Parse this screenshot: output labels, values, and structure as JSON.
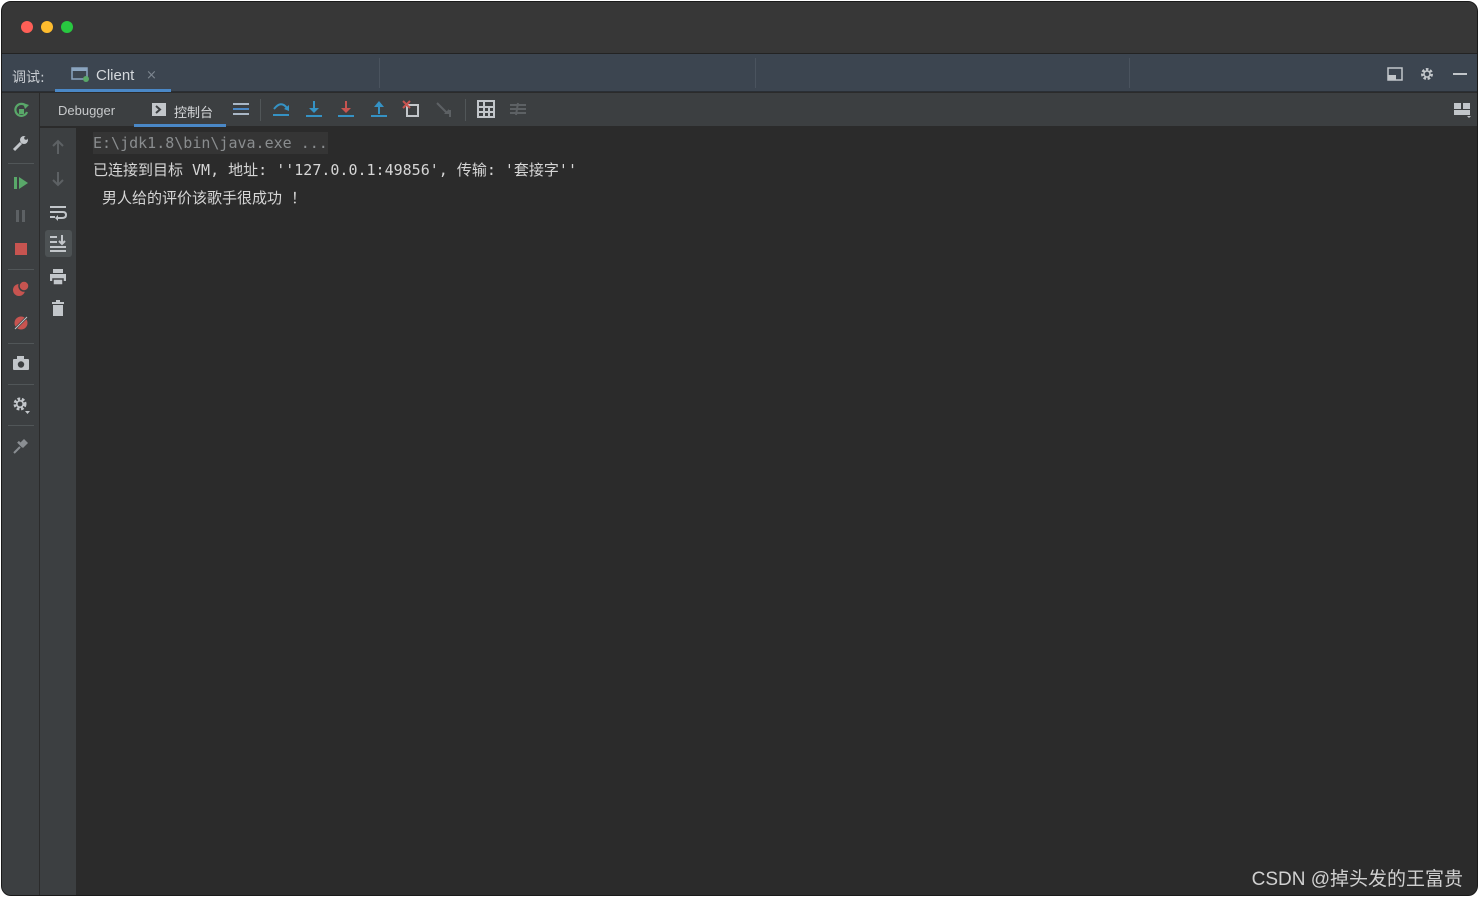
{
  "header": {
    "debug_label": "调试:",
    "client_tab": {
      "label": "Client",
      "close": "×"
    }
  },
  "tabs": {
    "debugger": "Debugger",
    "console": "控制台"
  },
  "console": {
    "lines": [
      "E:\\jdk1.8\\bin\\java.exe ...",
      "已连接到目标 VM, 地址: ''127.0.0.1:49856', 传输: '套接字''",
      " 男人给的评价该歌手很成功 ！"
    ]
  },
  "watermark": "CSDN @掉头发的王富贵",
  "colors": {
    "accent": "#4a88c7",
    "background": "#2b2b2b",
    "toolbar": "#3c3f41",
    "header": "#3c4550",
    "resume_green": "#59a869",
    "stop_red": "#c75450"
  },
  "icons": {
    "left_toolbar": [
      "rerun-icon",
      "settings-wrench-icon",
      "resume-icon",
      "pause-icon",
      "stop-icon",
      "view-breakpoints-icon",
      "mute-breakpoints-icon",
      "camera-icon",
      "gear-icon",
      "pin-icon"
    ],
    "console_toolbar": [
      "up-arrow-icon",
      "down-arrow-icon",
      "soft-wrap-icon",
      "scroll-to-end-icon",
      "print-icon",
      "clear-icon"
    ]
  }
}
